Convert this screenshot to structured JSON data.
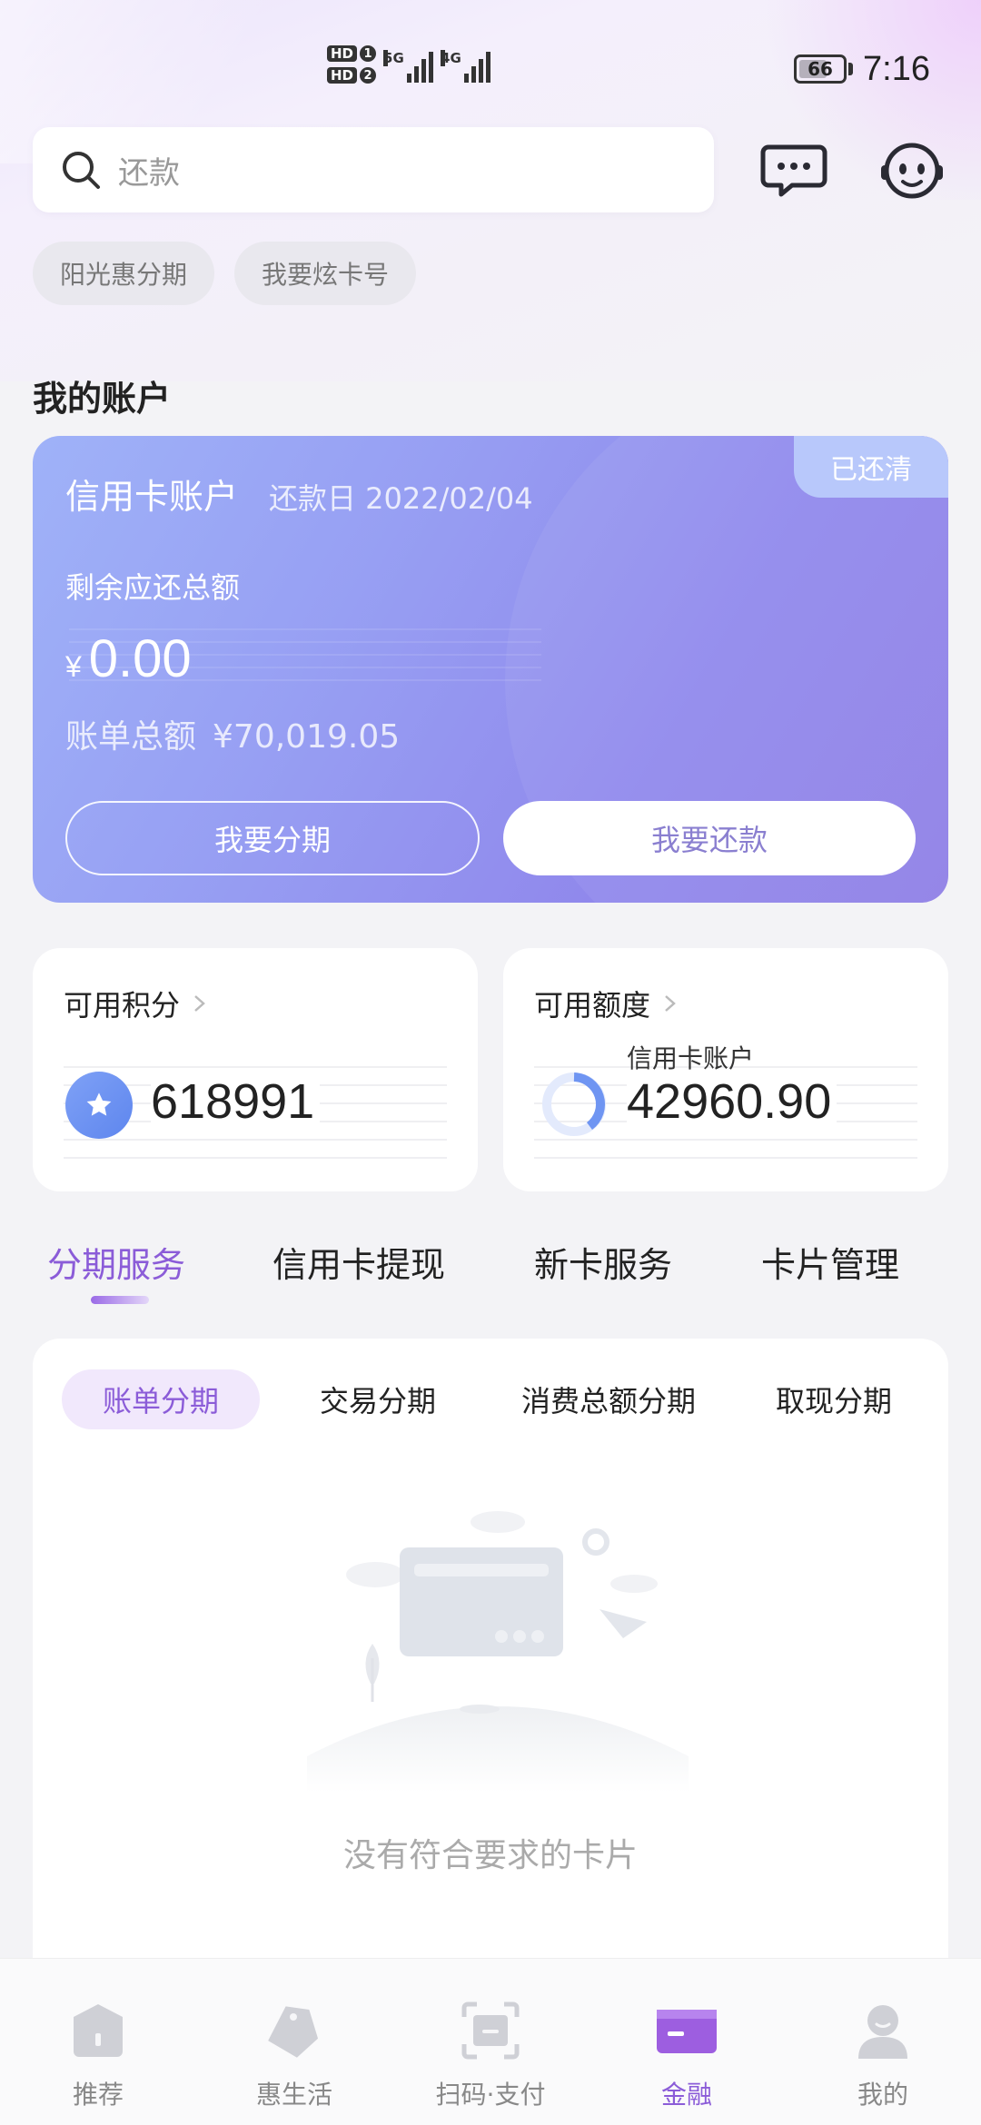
{
  "status_bar": {
    "hd1": "HD",
    "hd1_num": "1",
    "hd2": "HD",
    "hd2_num": "2",
    "net1": "5G",
    "net2": "4G",
    "battery": "66",
    "time": "7:16"
  },
  "search": {
    "placeholder": "还款"
  },
  "header_icons": [
    "chat-icon",
    "assistant-robot-icon"
  ],
  "chips": [
    "阳光惠分期",
    "我要炫卡号"
  ],
  "section_title": "我的账户",
  "account_card": {
    "title": "信用卡账户",
    "due_date": "还款日 2022/02/04",
    "badge": "已还清",
    "remain_label": "剩余应还总额",
    "currency": "¥",
    "remain_amount": "0.00",
    "bill_total_label": "账单总额",
    "bill_total_value": "¥70,019.05",
    "btn_split": "我要分期",
    "btn_repay": "我要还款"
  },
  "points": {
    "label": "可用积分",
    "value": "618991"
  },
  "credit": {
    "label": "可用额度",
    "sub": "信用卡账户",
    "value": "42960.90"
  },
  "main_tabs": [
    "分期服务",
    "信用卡提现",
    "新卡服务",
    "卡片管理"
  ],
  "sub_tabs": [
    "账单分期",
    "交易分期",
    "消费总额分期",
    "取现分期"
  ],
  "empty_text": "没有符合要求的卡片",
  "bottom_nav": [
    {
      "label": "推荐",
      "icon": "recommend-icon"
    },
    {
      "label": "惠生活",
      "icon": "tag-icon"
    },
    {
      "label": "扫码·支付",
      "icon": "scan-icon"
    },
    {
      "label": "金融",
      "icon": "card-icon"
    },
    {
      "label": "我的",
      "icon": "profile-icon"
    }
  ],
  "colors": {
    "accent": "#8b5cd8",
    "card_gradient_start": "#9fb2f8",
    "card_gradient_end": "#8f7fe6",
    "points_icon": "#6a8ff0"
  }
}
